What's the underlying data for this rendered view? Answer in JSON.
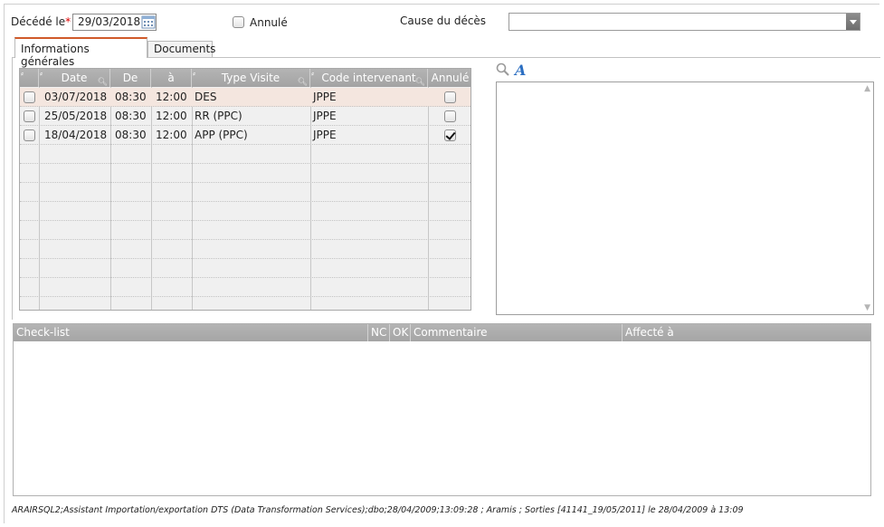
{
  "header": {
    "deces_label": "Décédé le",
    "required_mark": "*",
    "deces_date": "29/03/2018",
    "annule_label": "Annulé",
    "annule_checked": false,
    "cause_label": "Cause du décès",
    "cause_value": ""
  },
  "tabs": [
    {
      "label": "Informations générales",
      "active": true
    },
    {
      "label": "Documents",
      "active": false
    }
  ],
  "visits_grid": {
    "columns": [
      "",
      "Date",
      "De",
      "à",
      "Type Visite",
      "Code intervenant",
      "Annulé"
    ],
    "rows": [
      {
        "selected": false,
        "date": "03/07/2018",
        "de": "08:30",
        "a": "12:00",
        "type": "DES",
        "code": "JPPE",
        "annule": false,
        "highlight": true
      },
      {
        "selected": false,
        "date": "25/05/2018",
        "de": "08:30",
        "a": "12:00",
        "type": "RR (PPC)",
        "code": "JPPE",
        "annule": false,
        "highlight": false
      },
      {
        "selected": false,
        "date": "18/04/2018",
        "de": "08:30",
        "a": "12:00",
        "type": "APP (PPC)",
        "code": "JPPE",
        "annule": true,
        "highlight": false
      }
    ]
  },
  "icons": {
    "zoom": "magnifier-icon",
    "font": "font-style-icon",
    "calendar": "calendar-icon"
  },
  "checklist": {
    "columns": [
      "Check-list",
      "NC",
      "OK",
      "Commentaire",
      "Affecté à"
    ]
  },
  "footer": {
    "text": "ARAIRSQL2;Assistant Importation/exportation DTS (Data Transformation Services);dbo;28/04/2009;13:09:28 ; Aramis ; Sorties [41141_19/05/2011] le 28/04/2009 à 13:09"
  },
  "colors": {
    "accent_tab": "#d05a2a",
    "grid_header": "#a9a9a9",
    "selected_row": "#f4e6df",
    "required": "#dd0000"
  }
}
